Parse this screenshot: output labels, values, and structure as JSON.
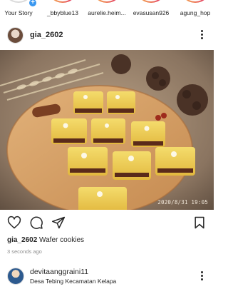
{
  "stories": [
    {
      "label": "Your Story"
    },
    {
      "label": "_bbyblue13"
    },
    {
      "label": "aurelie.heim..."
    },
    {
      "label": "evasusan926"
    },
    {
      "label": "agung_hop"
    }
  ],
  "post": {
    "username": "gia_2602",
    "caption_user": "gia_2602",
    "caption_text": "Wafer cookies",
    "posted_time": "3 seconds ago",
    "image_timestamp": "2020/8/31  19:05"
  },
  "next_post": {
    "username": "devitaanggraini11",
    "location": "Desa Tebing Kecamatan Kelapa"
  },
  "icons": {
    "like": "heart-icon",
    "comment": "comment-icon",
    "share": "send-icon",
    "save": "bookmark-icon",
    "more": "more-vertical-icon"
  },
  "colors": {
    "text": "#262626",
    "secondary": "#8e8e8e",
    "story_ring_start": "#f9c846",
    "story_ring_end": "#c13584",
    "badge_blue": "#3897f0"
  }
}
